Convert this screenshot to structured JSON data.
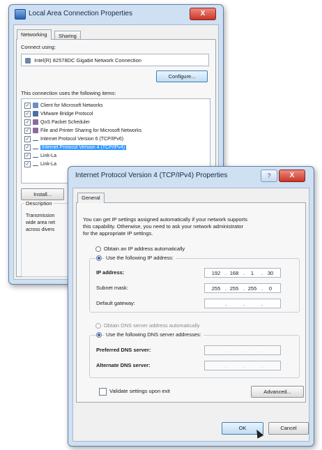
{
  "back_dialog": {
    "title": "Local Area Connection Properties",
    "close_label": "X",
    "tabs": [
      "Networking",
      "Sharing"
    ],
    "connect_using_label": "Connect using:",
    "adapter_name": "Intel(R) 82578DC Gigabit Network Connection",
    "configure_label": "Configure...",
    "items_label": "This connection uses the following items:",
    "items": [
      {
        "label": "Client for Microsoft Networks",
        "checked": true
      },
      {
        "label": "VMware Bridge Protocol",
        "checked": true
      },
      {
        "label": "QoS Packet Scheduler",
        "checked": true
      },
      {
        "label": "File and Printer Sharing for Microsoft Networks",
        "checked": true
      },
      {
        "label": "Internet Protocol Version 6 (TCP/IPv6)",
        "checked": true
      },
      {
        "label": "Internet Protocol Version 4 (TCP/IPv4)",
        "checked": true,
        "selected": true
      },
      {
        "label": "Link-La",
        "checked": true
      },
      {
        "label": "Link-La",
        "checked": true
      }
    ],
    "install_label": "Install...",
    "description_label": "Description",
    "description_lines": [
      "Transmission",
      "wide area net",
      "across divers"
    ]
  },
  "front_dialog": {
    "title": "Internet Protocol Version 4 (TCP/IPv4) Properties",
    "help_label": "?",
    "close_label": "X",
    "tab": "General",
    "intro_lines": [
      "You can get IP settings assigned automatically if your network supports",
      "this capability. Otherwise, you need to ask your network administrator",
      "for the appropriate IP settings."
    ],
    "auto_ip_label": "Obtain an IP address automatically",
    "manual_ip_label": "Use the following IP address:",
    "ip_address_label": "IP address:",
    "ip_address": [
      "192",
      "168",
      "1",
      "30"
    ],
    "subnet_label": "Subnet mask:",
    "subnet": [
      "255",
      "255",
      "255",
      "0"
    ],
    "gateway_label": "Default gateway:",
    "auto_dns_label": "Obtain DNS server address automatically",
    "manual_dns_label": "Use the following DNS server addresses:",
    "preferred_dns_label": "Preferred DNS server:",
    "alternate_dns_label": "Alternate DNS server:",
    "validate_label": "Validate settings upon exit",
    "advanced_label": "Advanced...",
    "ok_label": "OK",
    "cancel_label": "Cancel"
  },
  "colors": {
    "selection": "#3399ff",
    "title_close": "#c9362a",
    "frame": "#cfe0f3"
  }
}
